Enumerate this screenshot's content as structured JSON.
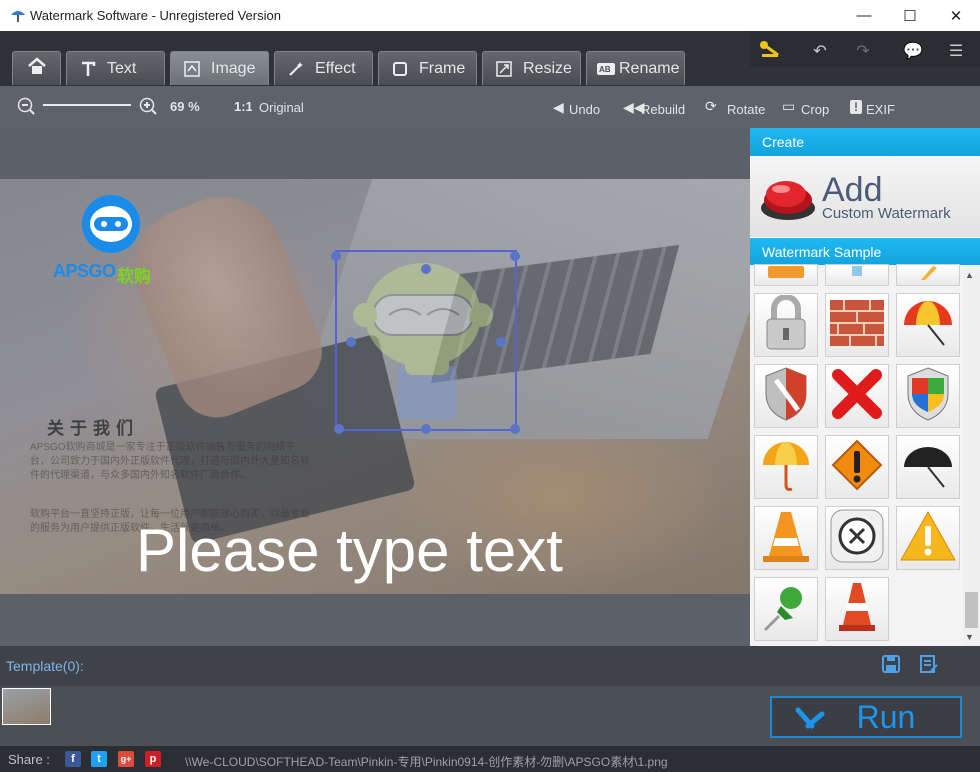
{
  "window": {
    "title": "Watermark Software - Unregistered Version",
    "controls": [
      "—",
      "☐",
      "✕"
    ]
  },
  "tabs": [
    {
      "label": "Text",
      "icon": "text-icon"
    },
    {
      "label": "Image",
      "icon": "image-icon",
      "active": true
    },
    {
      "label": "Effect",
      "icon": "magic-wand-icon"
    },
    {
      "label": "Frame",
      "icon": "frame-icon"
    },
    {
      "label": "Resize",
      "icon": "resize-icon"
    },
    {
      "label": "Rename",
      "icon": "rename-icon"
    }
  ],
  "toolbar": {
    "zoom_percent": "69 %",
    "zoom_level": 0.69,
    "original_label": "Original",
    "undo_label": "Undo",
    "rebuild_label": "Rebuild",
    "rotate_label": "Rotate",
    "crop_label": "Crop",
    "exif_label": "EXIF"
  },
  "canvas": {
    "watermark_text": "Please type text",
    "logo_text": "APSGO",
    "logo_text_cn": "软购",
    "about_title": "关于我们",
    "about_p1": "APSGO软购商城是一家专注于正版软件销售与服务的网络平台，公司致力于国内外正版软件代理，打造与国内外大量知名软件的代理渠道，与众多国内外知名软件厂商合作。",
    "about_p2": "软购平台一直坚持正版，让每一位用户都能放心购买，以最专业的服务为用户提供正版软件，生活就更简单。"
  },
  "side": {
    "create_label": "Create",
    "add_big": "Add",
    "add_sub": "Custom Watermark",
    "sample_label": "Watermark Sample",
    "samples": [
      "bar-icon",
      "drop-icon",
      "pencil-icon",
      "padlock-icon",
      "brick-wall-icon",
      "umbrella-red-icon",
      "shield-red-icon",
      "red-x-icon",
      "windows-shield-icon",
      "umbrella-orange-icon",
      "warning-orange-icon",
      "umbrella-black-icon",
      "traffic-cone-icon",
      "close-circle-icon",
      "warning-yellow-icon",
      "pushpin-icon",
      "cone-small-icon"
    ]
  },
  "template": {
    "label": "Template(0):"
  },
  "run": {
    "label": "Run"
  },
  "status": {
    "share_label": "Share :",
    "social": [
      "f",
      "t",
      "g+",
      "p"
    ],
    "path": "\\\\We-CLOUD\\SOFTHEAD-Team\\Pinkin-专用\\Pinkin0914-创作素材-勿删\\APSGO素材\\1.png"
  },
  "colors": {
    "accent": "#1c96e8",
    "panel_header": "#13a3dc",
    "run_text": "#1c96e8"
  }
}
